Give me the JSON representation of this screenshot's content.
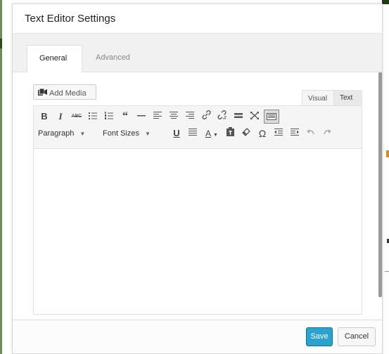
{
  "dialog": {
    "title": "Text Editor Settings"
  },
  "tabs": [
    {
      "label": "General",
      "active": true
    },
    {
      "label": "Advanced",
      "active": false
    }
  ],
  "editor": {
    "add_media_label": "Add Media",
    "mode_tabs": {
      "visual": "Visual",
      "text": "Text"
    },
    "toolbar_row1": [
      "bold-icon",
      "italic-icon",
      "strikethrough-icon",
      "bulleted-list-icon",
      "numbered-list-icon",
      "blockquote-icon",
      "horizontal-line-icon",
      "align-left-icon",
      "align-center-icon",
      "align-right-icon",
      "link-icon",
      "unlink-icon",
      "read-more-icon",
      "fullscreen-icon",
      "toolbar-toggle-icon"
    ],
    "toolbar_row2_selects": {
      "paragraph": "Paragraph",
      "font_sizes": "Font Sizes"
    },
    "toolbar_row2": [
      "underline-icon",
      "justify-icon",
      "text-color-icon",
      "paste-as-text-icon",
      "clear-formatting-icon",
      "special-character-icon",
      "outdent-icon",
      "indent-icon",
      "undo-icon",
      "redo-icon"
    ],
    "content": ""
  },
  "footer": {
    "save_label": "Save",
    "cancel_label": "Cancel"
  },
  "colors": {
    "save_bg": "#2ea2cc",
    "save_border": "#0074a2"
  }
}
